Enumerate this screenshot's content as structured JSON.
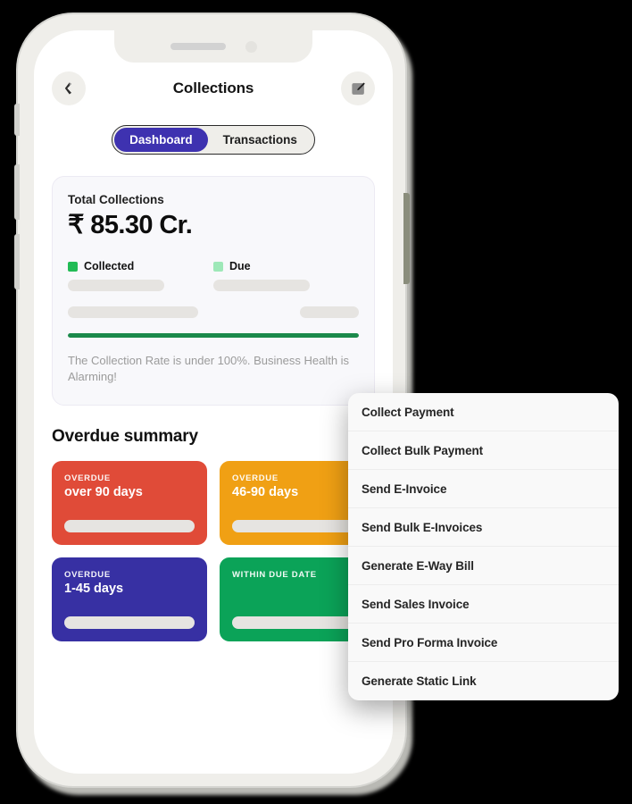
{
  "colors": {
    "background": "#000000",
    "phone_body": "#efeeea",
    "accent_purple": "#3e32b0",
    "collected_green": "#22bb55",
    "due_green": "#9ee8b8",
    "progress_green": "#1b8a4b",
    "card_red": "#e04b38",
    "card_orange": "#f0a014",
    "card_purple": "#3730a3",
    "card_green": "#0ba358"
  },
  "header": {
    "title": "Collections",
    "back_icon": "chevron-left-icon",
    "edit_icon": "edit-pencil-icon"
  },
  "tabs": [
    {
      "label": "Dashboard",
      "active": true
    },
    {
      "label": "Transactions",
      "active": false
    }
  ],
  "total_collections": {
    "label": "Total Collections",
    "amount": "₹ 85.30 Cr.",
    "legend": [
      {
        "label": "Collected",
        "color": "#22bb55"
      },
      {
        "label": "Due",
        "color": "#9ee8b8"
      }
    ],
    "progress_percent": 100,
    "note": "The Collection Rate is under 100%. Business Health is Alarming!"
  },
  "overdue_summary": {
    "title": "Overdue summary",
    "cards": [
      {
        "kicker": "OVERDUE",
        "value": "over 90 days",
        "color": "#e04b38"
      },
      {
        "kicker": "OVERDUE",
        "value": "46-90 days",
        "color": "#f0a014"
      },
      {
        "kicker": "OVERDUE",
        "value": "1-45 days",
        "color": "#3730a3"
      },
      {
        "kicker": "WITHIN DUE DATE",
        "value": "",
        "color": "#0ba358"
      }
    ]
  },
  "menu": {
    "items": [
      {
        "label": "Collect Payment"
      },
      {
        "label": "Collect Bulk Payment"
      },
      {
        "label": "Send E-Invoice"
      },
      {
        "label": "Send Bulk E-Invoices"
      },
      {
        "label": "Generate E-Way Bill"
      },
      {
        "label": "Send Sales Invoice"
      },
      {
        "label": "Send Pro Forma Invoice"
      },
      {
        "label": "Generate Static Link"
      }
    ]
  }
}
